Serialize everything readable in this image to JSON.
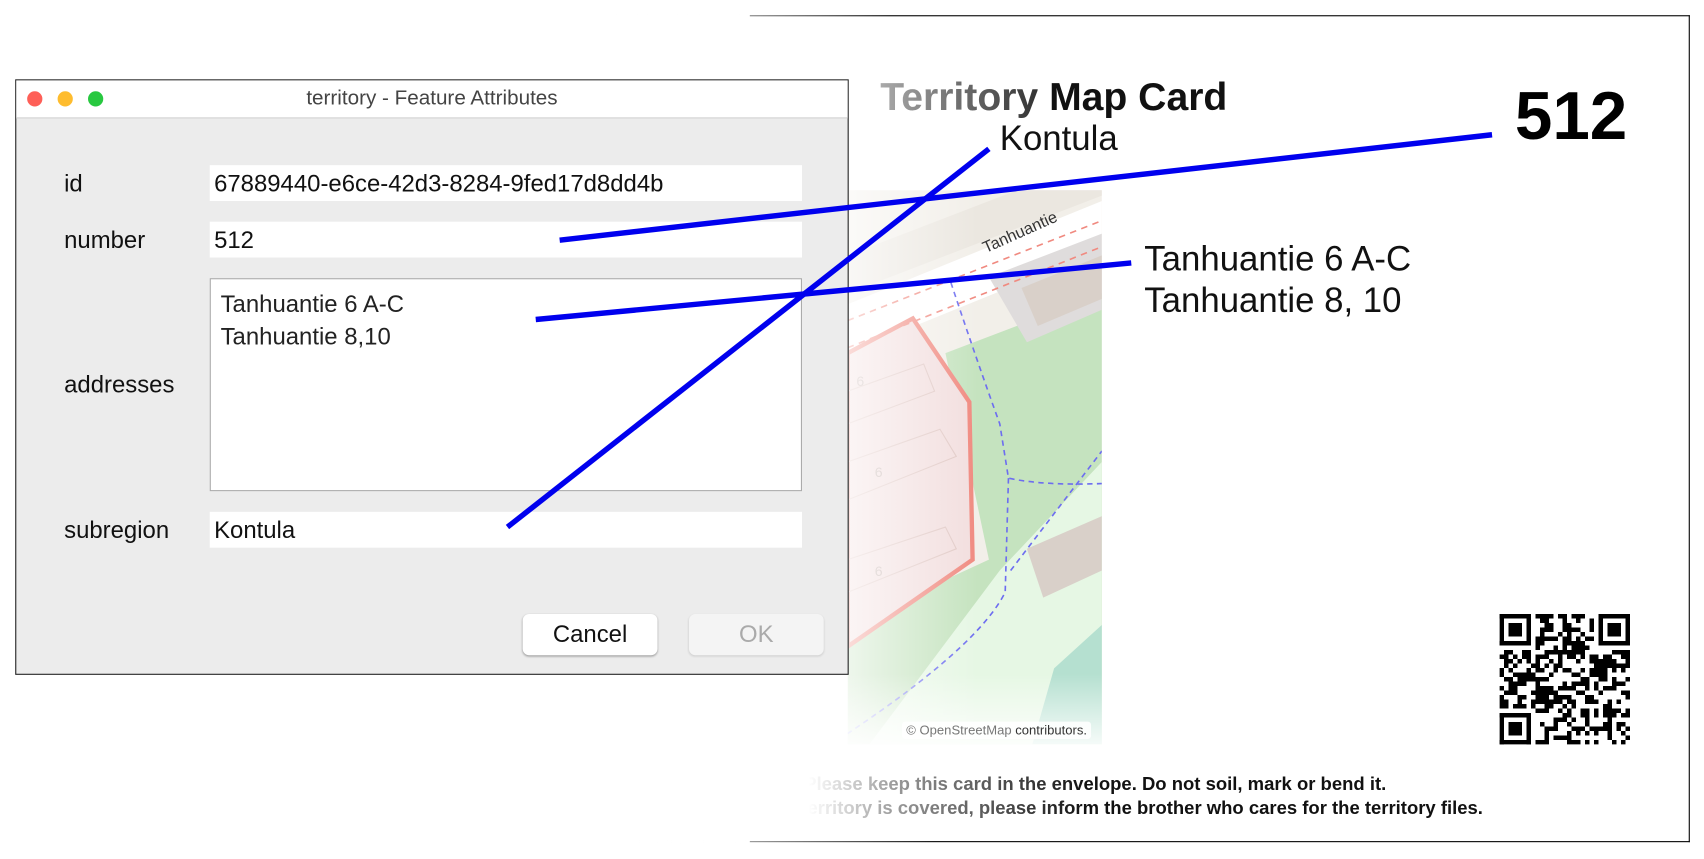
{
  "dialog": {
    "title": "territory - Feature Attributes",
    "window_controls": [
      "close",
      "minimize",
      "zoom"
    ],
    "fields": {
      "id": {
        "label": "id",
        "value": "67889440-e6ce-42d3-8284-9fed17d8dd4b"
      },
      "number": {
        "label": "number",
        "value": "512"
      },
      "addresses": {
        "label": "addresses",
        "lines": [
          "Tanhuantie 6 A-C",
          "Tanhuantie 8,10"
        ]
      },
      "subregion": {
        "label": "subregion",
        "value": "Kontula"
      }
    },
    "buttons": {
      "cancel": "Cancel",
      "ok": "OK"
    }
  },
  "card": {
    "title_part1": "Territory",
    "title_part2": " Map Card",
    "subregion": "Kontula",
    "number": "512",
    "addresses": [
      "Tanhuantie 6 A-C",
      "Tanhuantie 8, 10"
    ],
    "map": {
      "street_label": "Tanhuantie",
      "house_numbers": [
        "6",
        "6",
        "6"
      ],
      "attribution_prefix": "© OpenStreetMap",
      "attribution_suffix": " contributors."
    },
    "footer": [
      "Please keep this card in the envelope. Do not soil, mark or bend it.",
      "If the territory is covered, please inform the brother who cares for the territory files."
    ]
  },
  "colors": {
    "annotation_line": "#0000ee",
    "close": "#fe5f57",
    "minimize": "#febc2e",
    "zoom": "#28c840",
    "territory_outline": "#f08a80"
  }
}
